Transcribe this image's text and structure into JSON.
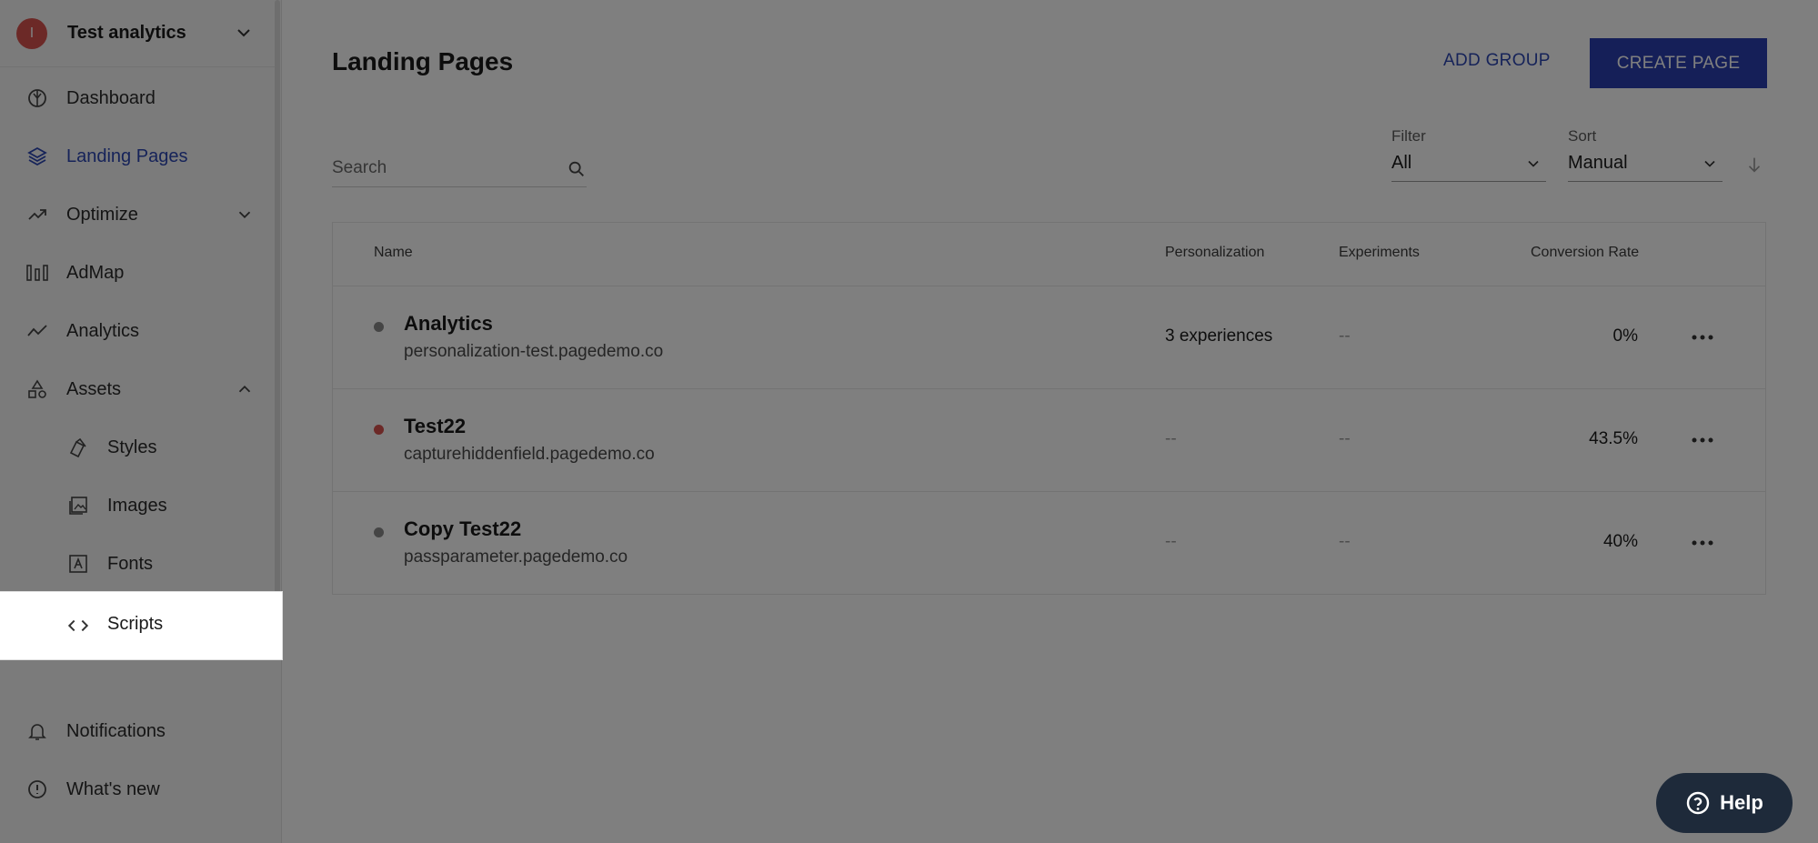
{
  "workspace": {
    "avatar_letter": "I",
    "name": "Test analytics"
  },
  "sidebar": {
    "items": [
      {
        "label": "Dashboard",
        "icon": "dashboard-icon"
      },
      {
        "label": "Landing Pages",
        "icon": "layers-icon"
      },
      {
        "label": "Optimize",
        "icon": "trend-icon"
      },
      {
        "label": "AdMap",
        "icon": "admap-icon"
      },
      {
        "label": "Analytics",
        "icon": "analytics-icon"
      },
      {
        "label": "Assets",
        "icon": "shapes-icon"
      },
      {
        "label": "Styles",
        "icon": "styles-icon"
      },
      {
        "label": "Images",
        "icon": "images-icon"
      },
      {
        "label": "Fonts",
        "icon": "font-icon"
      },
      {
        "label": "Scripts",
        "icon": "code-icon"
      }
    ],
    "bottom": [
      {
        "label": "Notifications",
        "icon": "bell-icon"
      },
      {
        "label": "What's new",
        "icon": "info-icon"
      }
    ]
  },
  "header": {
    "title": "Landing Pages",
    "add_group": "ADD GROUP",
    "create_page": "CREATE PAGE"
  },
  "search": {
    "placeholder": "Search"
  },
  "filter": {
    "caption": "Filter",
    "value": "All"
  },
  "sort": {
    "caption": "Sort",
    "value": "Manual"
  },
  "table": {
    "columns": [
      "Name",
      "Personalization",
      "Experiments",
      "Conversion Rate"
    ],
    "rows": [
      {
        "name": "Analytics",
        "url": "personalization-test.pagedemo.co",
        "personalization": "3 experiences",
        "experiments": "--",
        "conversion": "0%",
        "status_color": "#8b8b8b"
      },
      {
        "name": "Test22",
        "url": "capturehiddenfield.pagedemo.co",
        "personalization": "--",
        "experiments": "--",
        "conversion": "43.5%",
        "status_color": "#d9534f"
      },
      {
        "name": "Copy Test22",
        "url": "passparameter.pagedemo.co",
        "personalization": "--",
        "experiments": "--",
        "conversion": "40%",
        "status_color": "#8b8b8b"
      }
    ]
  },
  "help": {
    "label": "Help"
  },
  "colors": {
    "accent": "#2c46b3",
    "button": "#2b3fb0",
    "help_bg": "#1e2a3a"
  }
}
